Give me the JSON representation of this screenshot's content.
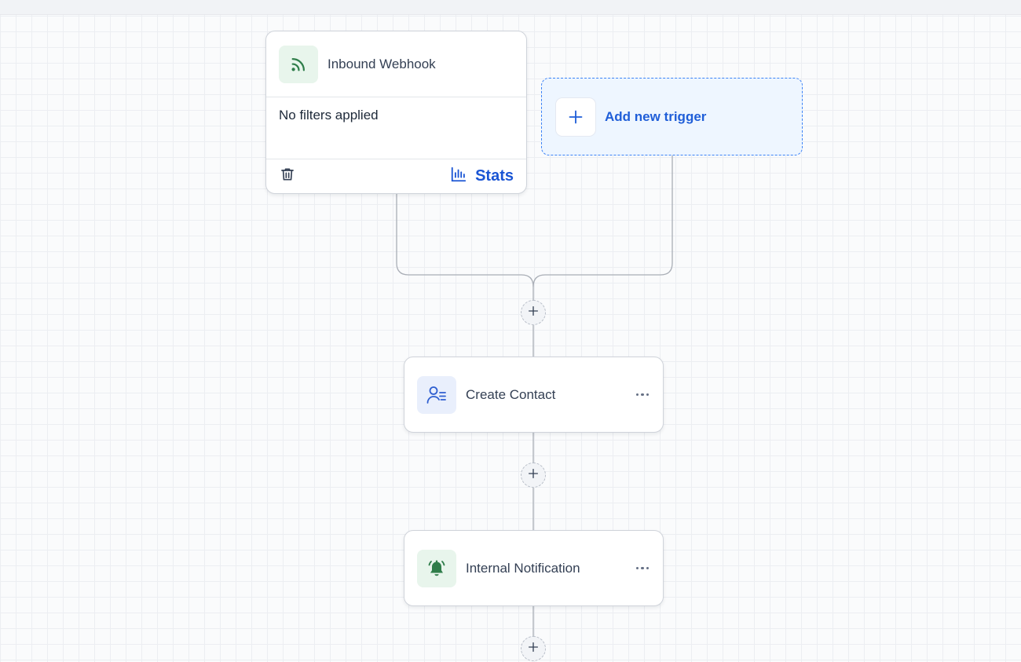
{
  "canvas": {
    "trigger": {
      "title": "Inbound Webhook",
      "icon": "rss-feed-icon",
      "filter_text": "No filters applied",
      "delete_icon": "trash-icon",
      "stats_icon": "bar-chart-icon",
      "stats_label": "Stats"
    },
    "add_trigger": {
      "icon": "plus-icon",
      "label": "Add new trigger"
    },
    "actions": [
      {
        "title": "Create Contact",
        "icon": "contact-list-icon",
        "menu_icon": "more-horizontal-icon"
      },
      {
        "title": "Internal Notification",
        "icon": "bell-icon",
        "menu_icon": "more-horizontal-icon"
      }
    ],
    "add_step_icon": "plus-icon"
  },
  "colors": {
    "accent_blue": "#1a55d4",
    "add_trigger_bg": "#eef6ff",
    "add_trigger_border": "#3b82f6",
    "icon_green": "#2f7d4a",
    "icon_green_bg": "#e8f5ec",
    "icon_blue_bg": "#e9effc",
    "connector": "#a9aeb6"
  }
}
